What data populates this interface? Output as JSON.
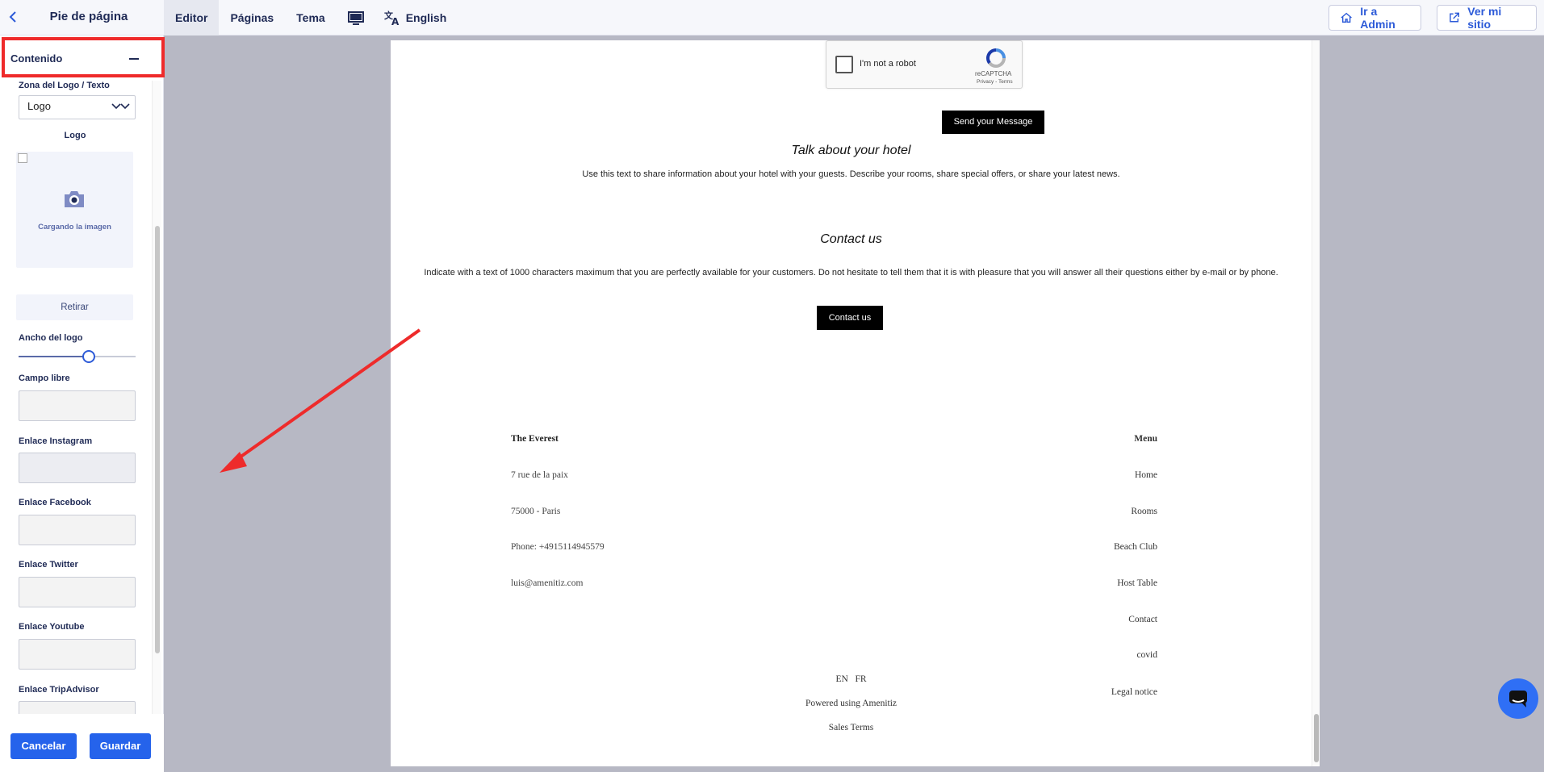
{
  "topbar": {
    "panel_title": "Pie de página",
    "tabs": [
      {
        "label": "Editor"
      },
      {
        "label": "Páginas"
      },
      {
        "label": "Tema"
      }
    ],
    "language": "English",
    "admin_button": "Ir a Admin",
    "view_site_button": "Ver mi sitio"
  },
  "panel": {
    "section_title": "Contenido",
    "logo_zone_label": "Zona del Logo / Texto",
    "logo_zone_value": "Logo",
    "logo_label": "Logo",
    "upload_text": "Cargando la imagen",
    "remove_button": "Retirar",
    "logo_width_label": "Ancho del logo",
    "logo_width_fraction": 0.6,
    "free_field_label": "Campo libre",
    "instagram_label": "Enlace Instagram",
    "facebook_label": "Enlace Facebook",
    "twitter_label": "Enlace Twitter",
    "youtube_label": "Enlace Youtube",
    "tripadvisor_label": "Enlace TripAdvisor",
    "cancel_button": "Cancelar",
    "save_button": "Guardar"
  },
  "preview": {
    "captcha_text": "I'm not a robot",
    "captcha_brand": "reCAPTCHA",
    "captcha_links": "Privacy - Terms",
    "send_button": "Send your Message",
    "hotel_heading": "Talk about your hotel",
    "hotel_text": "Use this text to share information about your hotel with your guests. Describe your rooms, share special offers, or share your latest news.",
    "contact_heading": "Contact us",
    "contact_text": "Indicate with a text of 1000 characters maximum that you are perfectly available for your customers. Do not hesitate to tell them that it is with pleasure that you will answer all their questions either by e-mail or by phone.",
    "contact_button": "Contact us",
    "footer": {
      "hotel_name": "The Everest",
      "address_line1": "7 rue de la paix",
      "address_line2": "75000 - Paris",
      "phone": "Phone: +4915114945579",
      "email": "luis@amenitiz.com",
      "menu_title": "Menu",
      "menu_items": [
        "Home",
        "Rooms",
        "Beach Club",
        "Host Table",
        "Contact",
        "covid",
        "Legal notice"
      ],
      "languages": "EN   FR",
      "powered": "Powered using Amenitiz",
      "sales_terms": "Sales Terms"
    }
  },
  "colors": {
    "accent": "#2563eb",
    "highlight": "#ef2a2a",
    "canvas_bg": "#b7b8c4"
  }
}
